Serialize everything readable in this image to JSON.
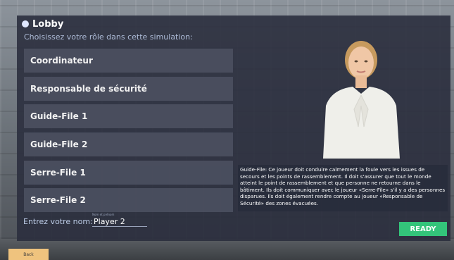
{
  "lobby": {
    "title": "Lobby",
    "subtitle": "Choisissez votre rôle dans cette simulation:"
  },
  "roles": [
    "Coordinateur",
    "Responsable de sécurité",
    "Guide-File 1",
    "Guide-File 2",
    "Serre-File 1",
    "Serre-File 2"
  ],
  "description": "Guide-File: Ce joueur doit conduire calmement la foule vers les issues de secours et les points de rassemblement. Il doit s'assurer que tout le monde atteint le point de rassemblement et que personne ne retourne dans le bâtiment. Ils doit communiquer avec le joueur «Serre-File» s'il y a des personnes disparues. Ils doit également rendre compte au joueur «Responsable de Sécurité» des zones évacuées.",
  "name_input": {
    "label": "Entrez votre nom:",
    "hint": "Nom et prénom",
    "value": "Player 2"
  },
  "buttons": {
    "ready": "READY",
    "back": "Back"
  },
  "colors": {
    "panel": "#2b2f3e",
    "role_button": "#4b4f60",
    "ready": "#33c47a",
    "back": "#efc37e",
    "subtitle": "#aebcd8"
  }
}
